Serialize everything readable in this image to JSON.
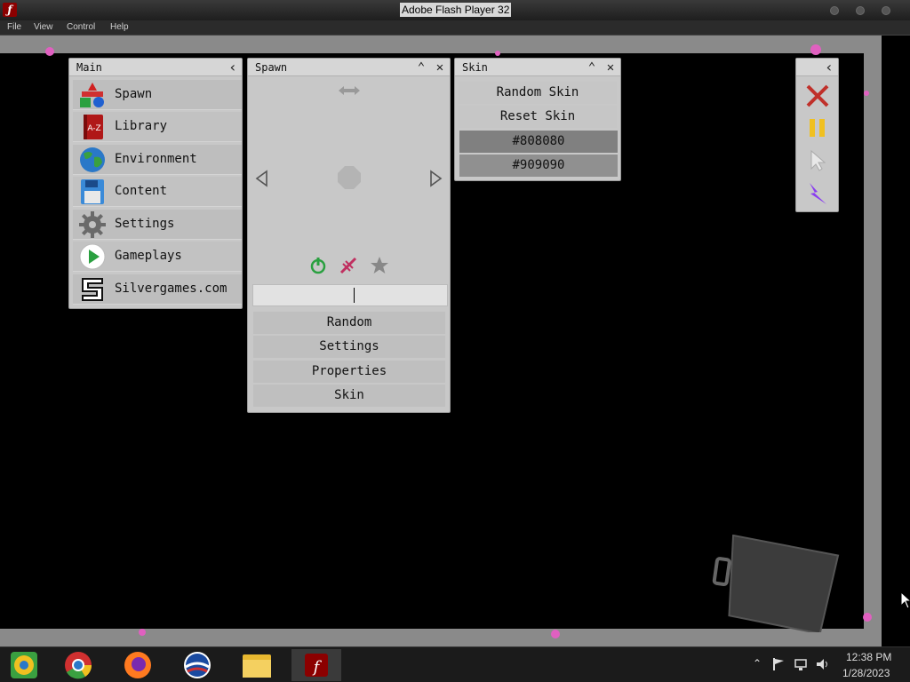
{
  "window": {
    "title": "Adobe Flash Player 32"
  },
  "menubar": [
    "File",
    "View",
    "Control",
    "Help"
  ],
  "main_panel": {
    "title": "Main",
    "items": [
      {
        "label": "Spawn",
        "icon": "spawn-shapes-icon"
      },
      {
        "label": "Library",
        "icon": "library-book-icon"
      },
      {
        "label": "Environment",
        "icon": "globe-icon"
      },
      {
        "label": "Content",
        "icon": "floppy-disk-icon"
      },
      {
        "label": "Settings",
        "icon": "gear-icon"
      },
      {
        "label": "Gameplays",
        "icon": "play-icon"
      },
      {
        "label": "Silvergames.com",
        "icon": "silvergames-s-icon"
      }
    ]
  },
  "spawn_panel": {
    "title": "Spawn",
    "input_value": "",
    "buttons": [
      "Random",
      "Settings",
      "Properties",
      "Skin"
    ]
  },
  "skin_panel": {
    "title": "Skin",
    "buttons": [
      "Random Skin",
      "Reset Skin"
    ],
    "colors": [
      "#808080",
      "#909090"
    ]
  },
  "taskbar": {
    "time": "12:38 PM",
    "date": "1/28/2023"
  },
  "colors": {
    "panel_bg": "#c8c8c8",
    "stage_bg": "#000000",
    "close_red": "#c0302a",
    "pause_yellow": "#f0c020",
    "lightning_purple": "#8a3cf0"
  }
}
